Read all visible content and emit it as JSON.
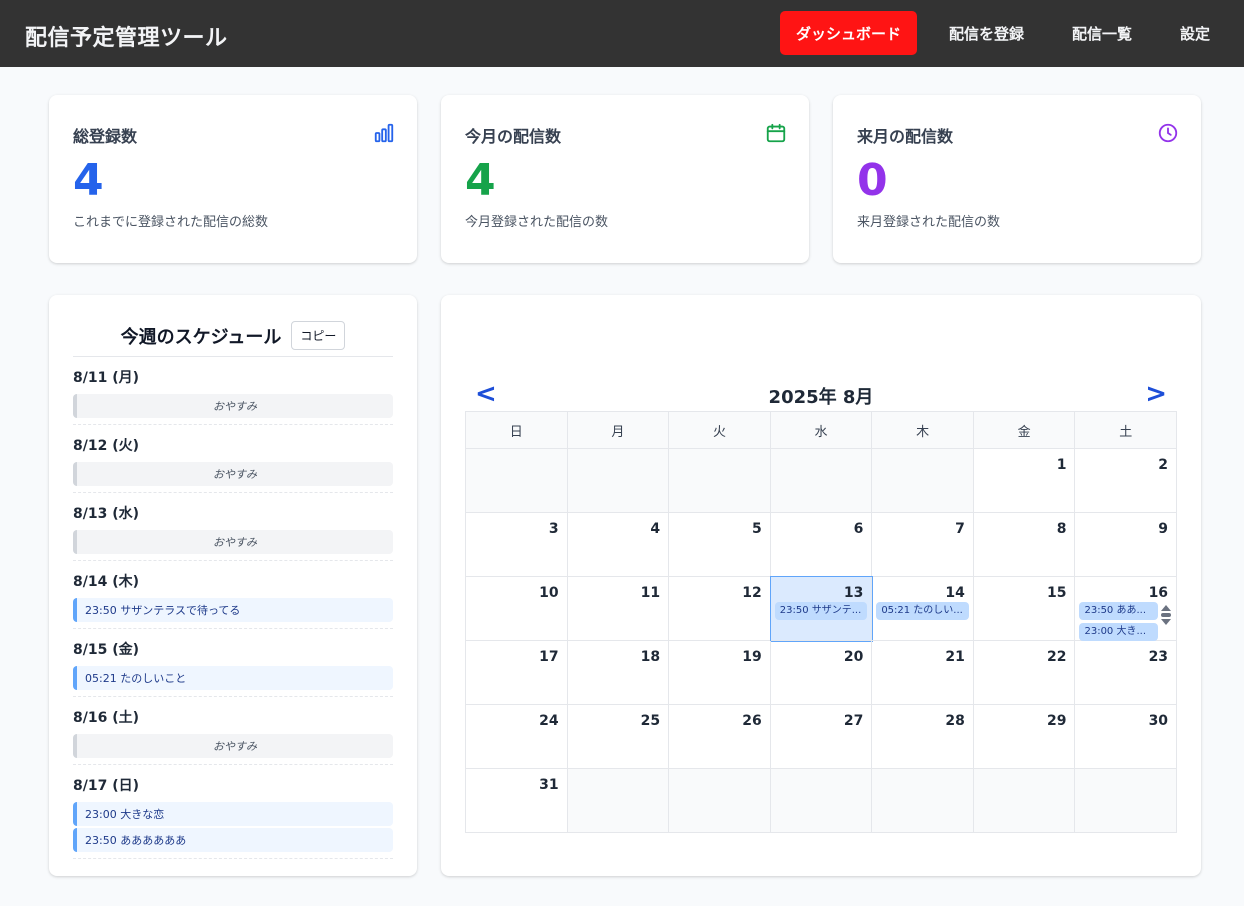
{
  "header": {
    "title": "配信予定管理ツール",
    "nav": [
      {
        "label": "ダッシュボード",
        "active": true
      },
      {
        "label": "配信を登録",
        "active": false
      },
      {
        "label": "配信一覧",
        "active": false
      },
      {
        "label": "設定",
        "active": false
      }
    ]
  },
  "stats": [
    {
      "title": "総登録数",
      "value": "4",
      "desc": "これまでに登録された配信の総数",
      "color": "#2563eb",
      "icon": "bar-chart-icon"
    },
    {
      "title": "今月の配信数",
      "value": "4",
      "desc": "今月登録された配信の数",
      "color": "#16a34a",
      "icon": "calendar-icon"
    },
    {
      "title": "来月の配信数",
      "value": "0",
      "desc": "来月登録された配信の数",
      "color": "#9333ea",
      "icon": "clock-icon"
    }
  ],
  "week": {
    "title": "今週のスケジュール",
    "copy_label": "コピー",
    "days": [
      {
        "label": "8/11 (月)",
        "entries": [
          {
            "type": "rest",
            "text": "おやすみ"
          }
        ]
      },
      {
        "label": "8/12 (火)",
        "entries": [
          {
            "type": "rest",
            "text": "おやすみ"
          }
        ]
      },
      {
        "label": "8/13 (水)",
        "entries": [
          {
            "type": "rest",
            "text": "おやすみ"
          }
        ]
      },
      {
        "label": "8/14 (木)",
        "entries": [
          {
            "type": "event",
            "text": "23:50 サザンテラスで待ってる"
          }
        ]
      },
      {
        "label": "8/15 (金)",
        "entries": [
          {
            "type": "event",
            "text": "05:21 たのしいこと"
          }
        ]
      },
      {
        "label": "8/16 (土)",
        "entries": [
          {
            "type": "rest",
            "text": "おやすみ"
          }
        ]
      },
      {
        "label": "8/17 (日)",
        "entries": [
          {
            "type": "event",
            "text": "23:00 大きな恋"
          },
          {
            "type": "event",
            "text": "23:50 ああああああ"
          }
        ]
      }
    ]
  },
  "calendar": {
    "title": "2025年 8月",
    "prev": "<",
    "next": ">",
    "weekdays": [
      "日",
      "月",
      "火",
      "水",
      "木",
      "金",
      "土"
    ],
    "weeks": [
      [
        {
          "day": ""
        },
        {
          "day": ""
        },
        {
          "day": ""
        },
        {
          "day": ""
        },
        {
          "day": ""
        },
        {
          "day": "1"
        },
        {
          "day": "2"
        }
      ],
      [
        {
          "day": "3"
        },
        {
          "day": "4"
        },
        {
          "day": "5"
        },
        {
          "day": "6"
        },
        {
          "day": "7"
        },
        {
          "day": "8"
        },
        {
          "day": "9"
        }
      ],
      [
        {
          "day": "10"
        },
        {
          "day": "11"
        },
        {
          "day": "12"
        },
        {
          "day": "13",
          "today": true,
          "events": [
            "23:50 サザンテ..."
          ]
        },
        {
          "day": "14",
          "events": [
            "05:21 たのしい..."
          ]
        },
        {
          "day": "15"
        },
        {
          "day": "16",
          "events": [
            "23:50 ああ...",
            "23:00 大き..."
          ],
          "scroll": true
        }
      ],
      [
        {
          "day": "17"
        },
        {
          "day": "18"
        },
        {
          "day": "19"
        },
        {
          "day": "20"
        },
        {
          "day": "21"
        },
        {
          "day": "22"
        },
        {
          "day": "23"
        }
      ],
      [
        {
          "day": "24"
        },
        {
          "day": "25"
        },
        {
          "day": "26"
        },
        {
          "day": "27"
        },
        {
          "day": "28"
        },
        {
          "day": "29"
        },
        {
          "day": "30"
        }
      ],
      [
        {
          "day": "31"
        },
        {
          "day": ""
        },
        {
          "day": ""
        },
        {
          "day": ""
        },
        {
          "day": ""
        },
        {
          "day": ""
        },
        {
          "day": ""
        }
      ]
    ]
  }
}
